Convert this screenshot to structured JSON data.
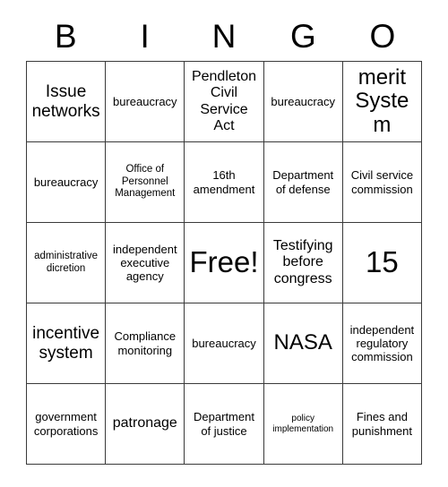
{
  "card": {
    "header_letters": [
      "B",
      "I",
      "N",
      "G",
      "O"
    ],
    "rows": [
      [
        {
          "text": "Issue networks",
          "size": "fs-xl"
        },
        {
          "text": "bureaucracy",
          "size": "fs-md"
        },
        {
          "text": "Pendleton Civil Service Act",
          "size": "fs-lg"
        },
        {
          "text": "bureaucracy",
          "size": "fs-md"
        },
        {
          "text": "merit System",
          "size": "fs-xxl"
        }
      ],
      [
        {
          "text": "bureaucracy",
          "size": "fs-md"
        },
        {
          "text": "Office of Personnel Management",
          "size": "fs-sm"
        },
        {
          "text": "16th amendment",
          "size": "fs-md"
        },
        {
          "text": "Department of defense",
          "size": "fs-md"
        },
        {
          "text": "Civil service commission",
          "size": "fs-md"
        }
      ],
      [
        {
          "text": "administrative dicretion",
          "size": "fs-sm"
        },
        {
          "text": "independent executive agency",
          "size": "fs-md"
        },
        {
          "text": "Free!",
          "size": "fs-huge"
        },
        {
          "text": "Testifying before congress",
          "size": "fs-lg"
        },
        {
          "text": "15",
          "size": "fs-huge"
        }
      ],
      [
        {
          "text": "incentive system",
          "size": "fs-xl"
        },
        {
          "text": "Compliance monitoring",
          "size": "fs-md"
        },
        {
          "text": "bureaucracy",
          "size": "fs-md"
        },
        {
          "text": "NASA",
          "size": "fs-xxl"
        },
        {
          "text": "independent regulatory commission",
          "size": "fs-md"
        }
      ],
      [
        {
          "text": "government corporations",
          "size": "fs-md"
        },
        {
          "text": "patronage",
          "size": "fs-lg"
        },
        {
          "text": "Department of justice",
          "size": "fs-md"
        },
        {
          "text": "policy implementation",
          "size": "fs-xs"
        },
        {
          "text": "Fines and punishment",
          "size": "fs-md"
        }
      ]
    ]
  }
}
